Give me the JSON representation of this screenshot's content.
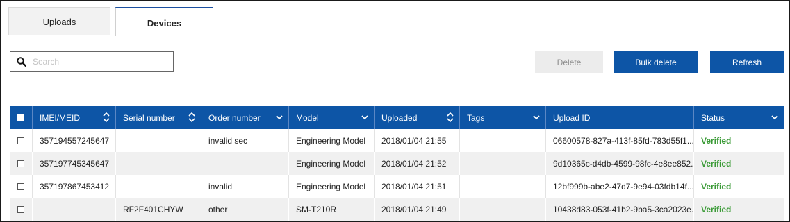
{
  "tabs": [
    {
      "label": "Uploads",
      "active": false
    },
    {
      "label": "Devices",
      "active": true
    }
  ],
  "search": {
    "placeholder": "Search",
    "value": "",
    "icon": "search-icon"
  },
  "toolbar": {
    "delete_label": "Delete",
    "bulk_delete_label": "Bulk delete",
    "refresh_label": "Refresh"
  },
  "colors": {
    "accent": "#0d55a6",
    "verified": "#3a9a36",
    "disabled_bg": "#ececec"
  },
  "table": {
    "columns": [
      {
        "label": "IMEI/MEID",
        "indicator": "sort"
      },
      {
        "label": "Serial number",
        "indicator": "sort"
      },
      {
        "label": "Order number",
        "indicator": "dropdown"
      },
      {
        "label": "Model",
        "indicator": "dropdown"
      },
      {
        "label": "Uploaded",
        "indicator": "sort"
      },
      {
        "label": "Tags",
        "indicator": "dropdown"
      },
      {
        "label": "Upload ID",
        "indicator": "none"
      },
      {
        "label": "Status",
        "indicator": "dropdown"
      }
    ],
    "rows": [
      {
        "imei": "357194557245647",
        "serial": "",
        "order": "invalid sec",
        "model": "Engineering Model",
        "uploaded": "2018/01/04 21:55",
        "tags": "",
        "upload_id": "06600578-827a-413f-85fd-783d55f1...",
        "status": "Verified"
      },
      {
        "imei": "357197745345647",
        "serial": "",
        "order": "",
        "model": "Engineering Model",
        "uploaded": "2018/01/04 21:52",
        "tags": "",
        "upload_id": "9d10365c-d4db-4599-98fc-4e8ee852...",
        "status": "Verified"
      },
      {
        "imei": "357197867453412",
        "serial": "",
        "order": "invalid",
        "model": "Engineering Model",
        "uploaded": "2018/01/04 21:51",
        "tags": "",
        "upload_id": "12bf999b-abe2-47d7-9e94-03fdb14f...",
        "status": "Verified"
      },
      {
        "imei": "",
        "serial": "RF2F401CHYW",
        "order": "other",
        "model": "SM-T210R",
        "uploaded": "2018/01/04 21:49",
        "tags": "",
        "upload_id": "10438d83-053f-41b2-9ba5-3ca2023e...",
        "status": "Verified"
      }
    ]
  }
}
